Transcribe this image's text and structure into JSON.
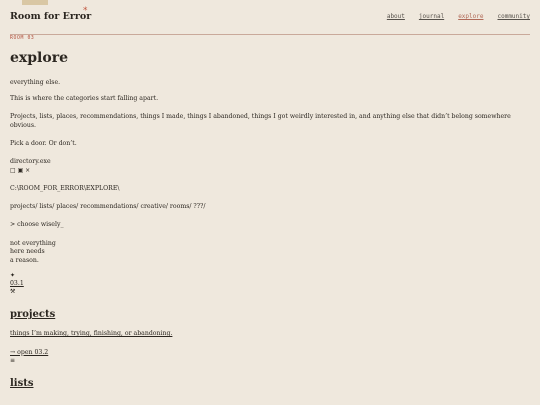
{
  "header": {
    "site_title": "Room for Error",
    "asterisk": "*",
    "nav": [
      "about",
      "journal",
      "explore",
      "community"
    ],
    "active": "explore"
  },
  "page": {
    "kicker": "ROOM 03",
    "title": "explore",
    "subtitle": "everything else.",
    "intro": "This is where the categories start falling apart.",
    "list_line": "Projects, lists, places, recommendations, things I made, things I abandoned, things I got weirdly interested in, and anything else that didn’t belong somewhere obvious.",
    "pick": "Pick a door. Or don’t."
  },
  "terminal": {
    "exe": "directory.exe",
    "window_controls": "□ ▣ ×",
    "path": "C:\\ROOM_FOR_ERROR\\EXPLORE\\",
    "folders": "projects/ lists/ places/ recommendations/ creative/ rooms/ ???/",
    "prompt": "> choose wisely_"
  },
  "poem": {
    "line1": "not everything",
    "line2": "here needs",
    "line3": "a reason."
  },
  "marker": {
    "glyph": "✦",
    "room_link": "03.1",
    "tool_glyph": "⚒"
  },
  "projects": {
    "title": "projects",
    "desc": "things I’m making, trying, finishing, or abandoning.",
    "link": "→ open 03.2",
    "glyph": "≡"
  },
  "lists": {
    "title": "lists"
  }
}
